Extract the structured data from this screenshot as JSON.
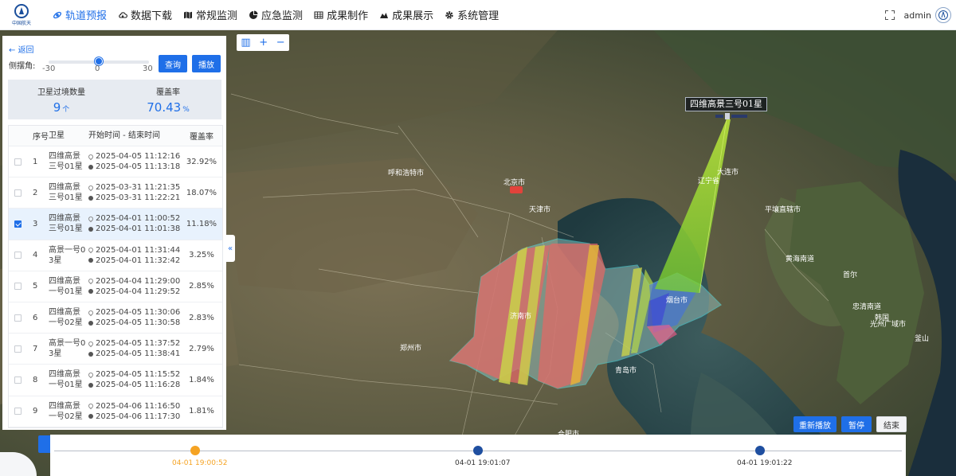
{
  "app": {
    "logo_caption": "中国航天",
    "nav": [
      {
        "label": "轨道预报",
        "icon": "orbit-icon",
        "active": true
      },
      {
        "label": "数据下载",
        "icon": "cloud-download-icon",
        "active": false
      },
      {
        "label": "常规监测",
        "icon": "map-icon",
        "active": false
      },
      {
        "label": "应急监测",
        "icon": "pie-icon",
        "active": false
      },
      {
        "label": "成果制作",
        "icon": "table-icon",
        "active": false
      },
      {
        "label": "成果展示",
        "icon": "mountain-chart-icon",
        "active": false
      },
      {
        "label": "系统管理",
        "icon": "gear-icon",
        "active": false
      }
    ],
    "user": "admin"
  },
  "panel": {
    "back": "返回",
    "tilt_label": "侧摆角:",
    "slider": {
      "min": "-30",
      "max": "30",
      "value": "0",
      "fraction": 0.5
    },
    "query_button": "查询",
    "play_button": "播放",
    "stats": [
      {
        "label": "卫星过境数量",
        "value": "9",
        "unit": "个"
      },
      {
        "label": "覆盖率",
        "value": "70.43",
        "unit": "%"
      }
    ],
    "table": {
      "headers": [
        "序号",
        "卫星",
        "开始时间 - 结束时间",
        "覆盖率"
      ],
      "rows": [
        {
          "no": "1",
          "sat1": "四维高景",
          "sat2": "三号01星",
          "start": "2025-04-05 11:12:16",
          "end": "2025-04-05 11:13:18",
          "cov": "32.92%",
          "checked": false
        },
        {
          "no": "2",
          "sat1": "四维高景",
          "sat2": "三号01星",
          "start": "2025-03-31 11:21:35",
          "end": "2025-03-31 11:22:21",
          "cov": "18.07%",
          "checked": false
        },
        {
          "no": "3",
          "sat1": "四维高景",
          "sat2": "三号01星",
          "start": "2025-04-01 11:00:52",
          "end": "2025-04-01 11:01:38",
          "cov": "11.18%",
          "checked": true
        },
        {
          "no": "4",
          "sat1": "高景一号0",
          "sat2": "3星",
          "start": "2025-04-01 11:31:44",
          "end": "2025-04-01 11:32:42",
          "cov": "3.25%",
          "checked": false
        },
        {
          "no": "5",
          "sat1": "四维高景",
          "sat2": "一号01星",
          "start": "2025-04-04 11:29:00",
          "end": "2025-04-04 11:29:52",
          "cov": "2.85%",
          "checked": false
        },
        {
          "no": "6",
          "sat1": "四维高景",
          "sat2": "一号02星",
          "start": "2025-04-05 11:30:06",
          "end": "2025-04-05 11:30:58",
          "cov": "2.83%",
          "checked": false
        },
        {
          "no": "7",
          "sat1": "高景一号0",
          "sat2": "3星",
          "start": "2025-04-05 11:37:52",
          "end": "2025-04-05 11:38:41",
          "cov": "2.79%",
          "checked": false
        },
        {
          "no": "8",
          "sat1": "四维高景",
          "sat2": "一号01星",
          "start": "2025-04-05 11:15:52",
          "end": "2025-04-05 11:16:28",
          "cov": "1.84%",
          "checked": false
        },
        {
          "no": "9",
          "sat1": "四维高景",
          "sat2": "一号02星",
          "start": "2025-04-06 11:16:50",
          "end": "2025-04-06 11:17:30",
          "cov": "1.81%",
          "checked": false
        }
      ]
    }
  },
  "map": {
    "tools": [
      "▥",
      "+",
      "−"
    ],
    "satellite_label": "四维高景三号01星",
    "city_labels": [
      "北京市",
      "天津市",
      "呼和浩特市",
      "大连市",
      "辽宁省",
      "烟台市",
      "济南市",
      "郑州市",
      "平壤直辖市",
      "首尔",
      "黄海南道",
      "光州广域市",
      "釜山",
      "忠清南道",
      "韩国",
      "青岛市",
      "合肥市"
    ],
    "collapse_icon": "«"
  },
  "playback": {
    "restart": "重新播放",
    "pause": "暂停",
    "stop": "结束"
  },
  "timeline": [
    {
      "label": "04-01 19:00:52",
      "current": true
    },
    {
      "label": "04-01 19:01:07",
      "current": false
    },
    {
      "label": "04-01 19:01:22",
      "current": false
    }
  ],
  "colors": {
    "accent": "#1f6fe8",
    "current": "#f5a323",
    "swath": "#9ad23a",
    "coverage": "#e05a5a"
  }
}
